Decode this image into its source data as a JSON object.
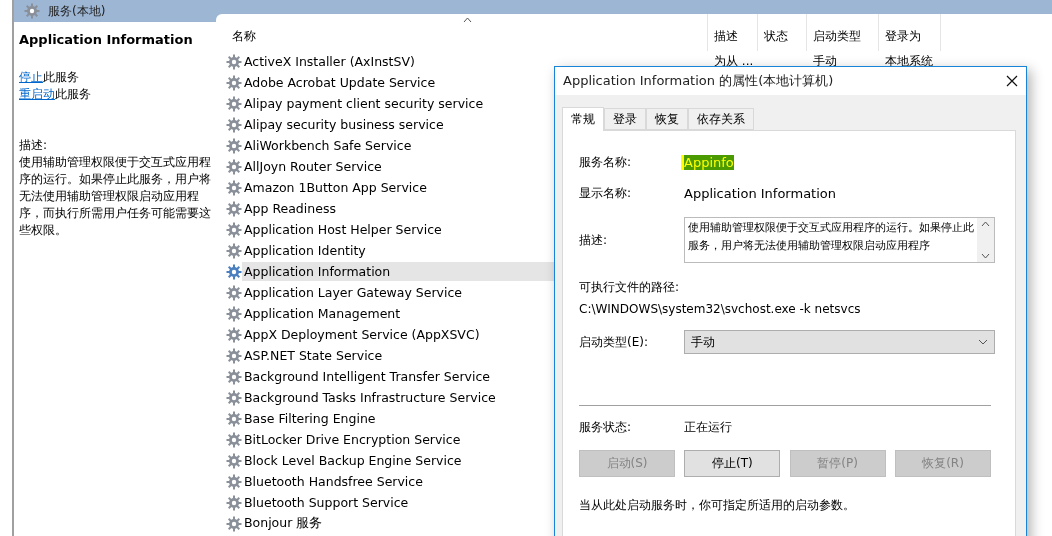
{
  "header": {
    "title": "服务(本地)"
  },
  "detail": {
    "title": "Application Information",
    "actions": [
      {
        "link": "停止",
        "text": "此服务"
      },
      {
        "link": "重启动",
        "text": "此服务"
      }
    ],
    "description_label": "描述:",
    "description": "使用辅助管理权限便于交互式应用程序的运行。如果停止此服务，用户将无法使用辅助管理权限启动应用程序，而执行所需用户任务可能需要这些权限。"
  },
  "table": {
    "columns": [
      {
        "label": "名称",
        "sorted": true
      },
      {
        "label": "描述",
        "sorted": false
      },
      {
        "label": "状态",
        "sorted": false
      },
      {
        "label": "启动类型",
        "sorted": false
      },
      {
        "label": "登录为",
        "sorted": false
      }
    ],
    "rows": [
      {
        "name": "ActiveX Installer (AxInstSV)",
        "description": "为从 ...",
        "startup": "手动",
        "logon": "本地系统",
        "selected": false
      },
      {
        "name": "Adobe Acrobat Update Service",
        "selected": false
      },
      {
        "name": "Alipay payment client security service",
        "selected": false
      },
      {
        "name": "Alipay security business service",
        "selected": false
      },
      {
        "name": "AliWorkbench Safe Service",
        "selected": false
      },
      {
        "name": "AllJoyn Router Service",
        "selected": false
      },
      {
        "name": "Amazon 1Button App Service",
        "selected": false
      },
      {
        "name": "App Readiness",
        "selected": false
      },
      {
        "name": "Application Host Helper Service",
        "selected": false
      },
      {
        "name": "Application Identity",
        "selected": false
      },
      {
        "name": "Application Information",
        "selected": true
      },
      {
        "name": "Application Layer Gateway Service",
        "selected": false
      },
      {
        "name": "Application Management",
        "selected": false
      },
      {
        "name": "AppX Deployment Service (AppXSVC)",
        "selected": false
      },
      {
        "name": "ASP.NET State Service",
        "selected": false
      },
      {
        "name": "Background Intelligent Transfer Service",
        "selected": false
      },
      {
        "name": "Background Tasks Infrastructure Service",
        "selected": false
      },
      {
        "name": "Base Filtering Engine",
        "selected": false
      },
      {
        "name": "BitLocker Drive Encryption Service",
        "selected": false
      },
      {
        "name": "Block Level Backup Engine Service",
        "selected": false
      },
      {
        "name": "Bluetooth Handsfree Service",
        "selected": false
      },
      {
        "name": "Bluetooth Support Service",
        "selected": false
      },
      {
        "name": "Bonjour 服务",
        "selected": false
      }
    ]
  },
  "dialog": {
    "title": "Application Information 的属性(本地计算机)",
    "tabs": [
      {
        "label": "常规",
        "selected": true
      },
      {
        "label": "登录",
        "selected": false
      },
      {
        "label": "恢复",
        "selected": false
      },
      {
        "label": "依存关系",
        "selected": false
      }
    ],
    "service_name": {
      "label": "服务名称:",
      "value": "Appinfo",
      "highlighted": true
    },
    "display_name": {
      "label": "显示名称:",
      "value": "Application Information"
    },
    "description": {
      "label": "描述:",
      "value": "使用辅助管理权限便于交互式应用程序的运行。如果停止此服务，用户将无法使用辅助管理权限启动应用程序"
    },
    "path": {
      "label": "可执行文件的路径:",
      "value": "C:\\WINDOWS\\system32\\svchost.exe -k netsvcs"
    },
    "startup_type": {
      "label": "启动类型(E):",
      "value": "手动"
    },
    "status": {
      "label": "服务状态:",
      "value": "正在运行"
    },
    "buttons": [
      {
        "label": "启动(S)",
        "disabled": true
      },
      {
        "label": "停止(T)",
        "disabled": false
      },
      {
        "label": "暂停(P)",
        "disabled": true
      },
      {
        "label": "恢复(R)",
        "disabled": true
      }
    ],
    "note": "当从此处启动服务时，你可指定所适用的启动参数。"
  }
}
